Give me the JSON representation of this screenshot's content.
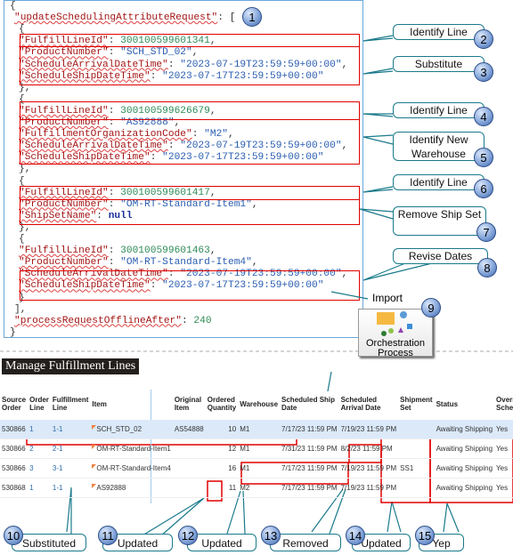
{
  "code_lines": [
    {
      "i": 0,
      "t": [
        [
          "{",
          ""
        ]
      ]
    },
    {
      "i": 1,
      "t": [
        [
          "\"updateSchedulingAttributeRequest\"",
          "k"
        ],
        [
          ": [",
          ""
        ]
      ]
    },
    {
      "i": 2,
      "t": [
        [
          "{",
          ""
        ]
      ]
    },
    {
      "i": 2,
      "t": [
        [
          "\"FulfillLineId\"",
          "k"
        ],
        [
          ": ",
          ""
        ],
        [
          "300100599601341",
          "n"
        ],
        [
          ",",
          ""
        ]
      ]
    },
    {
      "i": 2,
      "t": [
        [
          "\"ProductNumber\"",
          "k"
        ],
        [
          ": ",
          ""
        ],
        [
          "\"SCH_STD_02\"",
          "s"
        ],
        [
          ",",
          ""
        ]
      ]
    },
    {
      "i": 2,
      "t": [
        [
          "\"ScheduleArrivalDateTime\"",
          "k"
        ],
        [
          ": ",
          ""
        ],
        [
          "\"2023-07-19T23:59:59+00:00\"",
          "s"
        ],
        [
          ",",
          ""
        ]
      ]
    },
    {
      "i": 2,
      "t": [
        [
          "\"ScheduleShipDateTime\"",
          "k"
        ],
        [
          ": ",
          ""
        ],
        [
          "\"2023-07-17T23:59:59+00:00\"",
          "s"
        ]
      ]
    },
    {
      "i": 2,
      "t": [
        [
          "},",
          ""
        ]
      ]
    },
    {
      "i": 2,
      "t": [
        [
          "{",
          ""
        ]
      ]
    },
    {
      "i": 2,
      "t": [
        [
          "\"FulfillLineId\"",
          "k"
        ],
        [
          ": ",
          ""
        ],
        [
          "300100599626679",
          "n"
        ],
        [
          ",",
          ""
        ]
      ]
    },
    {
      "i": 2,
      "t": [
        [
          "\"ProductNumber\"",
          "k"
        ],
        [
          ": ",
          ""
        ],
        [
          "\"AS92888\"",
          "s"
        ],
        [
          ",",
          ""
        ]
      ]
    },
    {
      "i": 2,
      "t": [
        [
          "\"FulfillmentOrganizationCode\"",
          "k"
        ],
        [
          ": ",
          ""
        ],
        [
          "\"M2\"",
          "s"
        ],
        [
          ",",
          ""
        ]
      ]
    },
    {
      "i": 2,
      "t": [
        [
          "\"ScheduleArrivalDateTime\"",
          "k"
        ],
        [
          ": ",
          ""
        ],
        [
          "\"2023-07-19T23:59:59+00:00\"",
          "s"
        ],
        [
          ",",
          ""
        ]
      ]
    },
    {
      "i": 2,
      "t": [
        [
          "\"ScheduleShipDateTime\"",
          "k"
        ],
        [
          ": ",
          ""
        ],
        [
          "\"2023-07-17T23:59:59+00:00\"",
          "s"
        ]
      ]
    },
    {
      "i": 2,
      "t": [
        [
          "},",
          ""
        ]
      ]
    },
    {
      "i": 2,
      "t": [
        [
          "{",
          ""
        ]
      ]
    },
    {
      "i": 2,
      "t": [
        [
          "\"FulfillLineId\"",
          "k"
        ],
        [
          ": ",
          ""
        ],
        [
          "300100599601417",
          "n"
        ],
        [
          ",",
          ""
        ]
      ]
    },
    {
      "i": 2,
      "t": [
        [
          "\"ProductNumber\"",
          "k"
        ],
        [
          ": ",
          ""
        ],
        [
          "\"OM-RT-Standard-Item1\"",
          "s"
        ],
        [
          ",",
          ""
        ]
      ]
    },
    {
      "i": 2,
      "t": [
        [
          "\"ShipSetName\"",
          "k"
        ],
        [
          ": ",
          ""
        ],
        [
          "null",
          "b"
        ]
      ]
    },
    {
      "i": 2,
      "t": [
        [
          "},",
          ""
        ]
      ]
    },
    {
      "i": 2,
      "t": [
        [
          "{",
          ""
        ]
      ]
    },
    {
      "i": 2,
      "t": [
        [
          "\"FulfillLineId\"",
          "k"
        ],
        [
          ": ",
          ""
        ],
        [
          "300100599601463",
          "n"
        ],
        [
          ",",
          ""
        ]
      ]
    },
    {
      "i": 2,
      "t": [
        [
          "\"ProductNumber\"",
          "k"
        ],
        [
          ": ",
          ""
        ],
        [
          "\"OM-RT-Standard-Item4\"",
          "s"
        ],
        [
          ",",
          ""
        ]
      ]
    },
    {
      "i": 2,
      "t": [
        [
          "\"ScheduleArrivalDateTime\"",
          "k"
        ],
        [
          ": ",
          ""
        ],
        [
          "\"2023-07-19T23:59:59+00:00\"",
          "s"
        ],
        [
          ",",
          ""
        ]
      ]
    },
    {
      "i": 2,
      "t": [
        [
          "\"ScheduleShipDateTime\"",
          "k"
        ],
        [
          ": ",
          ""
        ],
        [
          "\"2023-07-17T23:59:59+00:00\"",
          "s"
        ]
      ]
    },
    {
      "i": 2,
      "t": [
        [
          "}",
          ""
        ]
      ]
    },
    {
      "i": 1,
      "t": [
        [
          "],",
          ""
        ]
      ]
    },
    {
      "i": 1,
      "t": [
        [
          "\"processRequestOfflineAfter\"",
          "k"
        ],
        [
          ": ",
          ""
        ],
        [
          "240",
          "n"
        ]
      ]
    },
    {
      "i": 0,
      "t": [
        [
          "}",
          ""
        ]
      ]
    }
  ],
  "callouts": {
    "c1": "1",
    "c2": {
      "n": "2",
      "label": "Identify Line"
    },
    "c3": {
      "n": "3",
      "label": "Substitute"
    },
    "c4": {
      "n": "4",
      "label": "Identify Line"
    },
    "c5": {
      "n": "5",
      "label": "Identify New Warehouse"
    },
    "c6": {
      "n": "6",
      "label": "Identify Line"
    },
    "c7": {
      "n": "7",
      "label": "Remove Ship Set"
    },
    "c8": {
      "n": "8",
      "label": "Revise Dates"
    },
    "c9": {
      "n": "9",
      "import": "Import",
      "label": "Orchestration Process"
    },
    "c10": {
      "n": "10",
      "label": "Substituted"
    },
    "c11": {
      "n": "11",
      "label": "Updated"
    },
    "c12": {
      "n": "12",
      "label": "Updated"
    },
    "c13": {
      "n": "13",
      "label": "Removed"
    },
    "c14": {
      "n": "14",
      "label": "Updated"
    },
    "c15": {
      "n": "15",
      "label": "Yep"
    }
  },
  "page_title": "Manage Fulfillment Lines",
  "table": {
    "headers": [
      "Source Order",
      "Order Line",
      "Fulfillment Line",
      "Item",
      "Original Item",
      "Ordered Quantity",
      "Warehouse",
      "Scheduled Ship Date",
      "Scheduled Arrival Date",
      "Shipment Set",
      "Status",
      "Override Schedule"
    ],
    "rows": [
      [
        "530866",
        "1",
        "1-1",
        "SCH_STD_02",
        "AS54888",
        "10",
        "M1",
        "7/17/23 11:59 PM",
        "7/19/23 11:59 PM",
        "",
        "Awaiting Shipping",
        "Yes"
      ],
      [
        "530866",
        "2",
        "2-1",
        "OM-RT-Standard-Item1",
        "",
        "12",
        "M1",
        "7/31/23 11:59 PM",
        "8/2/23 11:59 PM",
        "",
        "Awaiting Shipping",
        "Yes"
      ],
      [
        "530866",
        "3",
        "3-1",
        "OM-RT-Standard-Item4",
        "",
        "16",
        "M1",
        "7/17/23 11:59 PM",
        "7/19/23 11:59 PM",
        "SS1",
        "Awaiting Shipping",
        "Yes"
      ],
      [
        "530868",
        "1",
        "1-1",
        "AS92888",
        "",
        "11",
        "M2",
        "7/17/23 11:59 PM",
        "7/19/23 11:59 PM",
        "",
        "Awaiting Shipping",
        "Yes"
      ]
    ]
  },
  "colors": {
    "highlight_box": "#e00000",
    "callout_line": "#1a7a8c",
    "selected_row": "#dbe9f9"
  }
}
